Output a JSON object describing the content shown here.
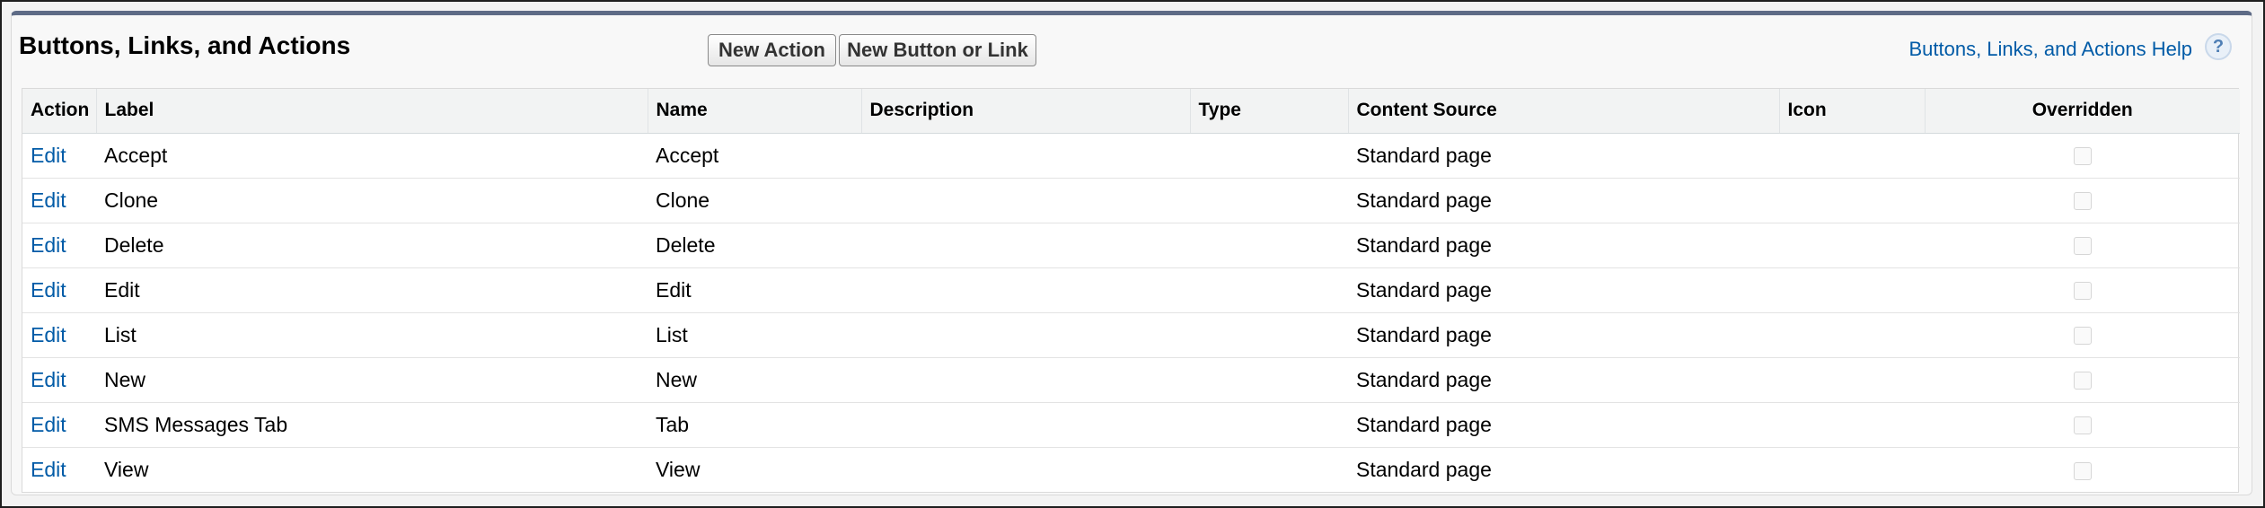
{
  "section": {
    "title": "Buttons, Links, and Actions",
    "new_action_label": "New Action",
    "new_button_label": "New Button or Link",
    "help_label": "Buttons, Links, and Actions Help",
    "help_icon": "question-icon",
    "help_glyph": "?"
  },
  "table": {
    "headers": {
      "action": "Action",
      "label": "Label",
      "name": "Name",
      "description": "Description",
      "type": "Type",
      "content_source": "Content Source",
      "icon": "Icon",
      "overridden": "Overridden"
    },
    "rows": [
      {
        "action": "Edit",
        "label": "Accept",
        "name": "Accept",
        "description": "",
        "type": "",
        "content_source": "Standard page",
        "icon": "",
        "overridden": false
      },
      {
        "action": "Edit",
        "label": "Clone",
        "name": "Clone",
        "description": "",
        "type": "",
        "content_source": "Standard page",
        "icon": "",
        "overridden": false
      },
      {
        "action": "Edit",
        "label": "Delete",
        "name": "Delete",
        "description": "",
        "type": "",
        "content_source": "Standard page",
        "icon": "",
        "overridden": false
      },
      {
        "action": "Edit",
        "label": "Edit",
        "name": "Edit",
        "description": "",
        "type": "",
        "content_source": "Standard page",
        "icon": "",
        "overridden": false
      },
      {
        "action": "Edit",
        "label": "List",
        "name": "List",
        "description": "",
        "type": "",
        "content_source": "Standard page",
        "icon": "",
        "overridden": false
      },
      {
        "action": "Edit",
        "label": "New",
        "name": "New",
        "description": "",
        "type": "",
        "content_source": "Standard page",
        "icon": "",
        "overridden": false
      },
      {
        "action": "Edit",
        "label": "SMS Messages Tab",
        "name": "Tab",
        "description": "",
        "type": "",
        "content_source": "Standard page",
        "icon": "",
        "overridden": false
      },
      {
        "action": "Edit",
        "label": "View",
        "name": "View",
        "description": "",
        "type": "",
        "content_source": "Standard page",
        "icon": "",
        "overridden": false
      }
    ]
  },
  "colors": {
    "link": "#015ba7",
    "header_bar": "#5e6b86"
  }
}
